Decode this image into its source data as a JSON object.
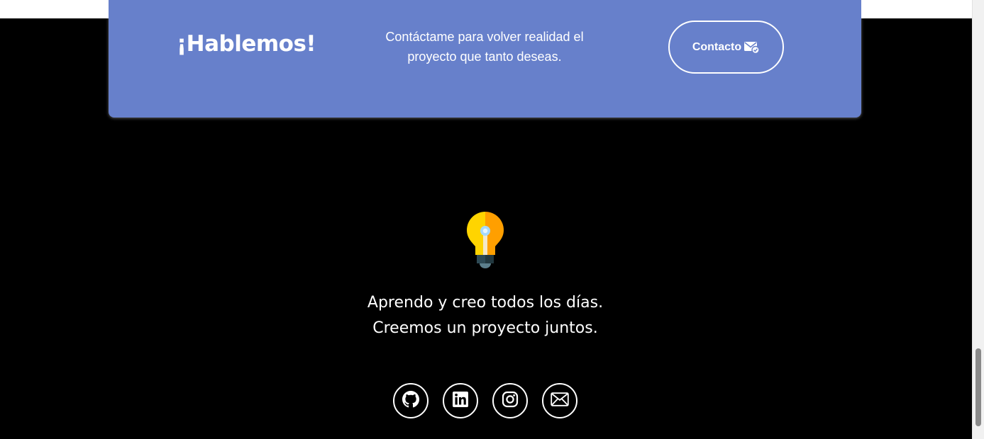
{
  "cta": {
    "title": "¡Hablemos!",
    "line1": "Contáctame para volver realidad el",
    "line2": "proyecto que tanto deseas.",
    "button_label": "Contacto",
    "button_icon": "mail-check-icon",
    "background": "#6780cb"
  },
  "footer": {
    "logo_icon": "lightbulb-icon",
    "line1": "Aprendo y creo todos los días.",
    "line2": "Creemos un proyecto juntos.",
    "socials": [
      {
        "name": "github",
        "icon": "github-icon"
      },
      {
        "name": "linkedin",
        "icon": "linkedin-icon"
      },
      {
        "name": "instagram",
        "icon": "instagram-icon"
      },
      {
        "name": "email",
        "icon": "mail-icon"
      }
    ],
    "background": "#000000"
  }
}
